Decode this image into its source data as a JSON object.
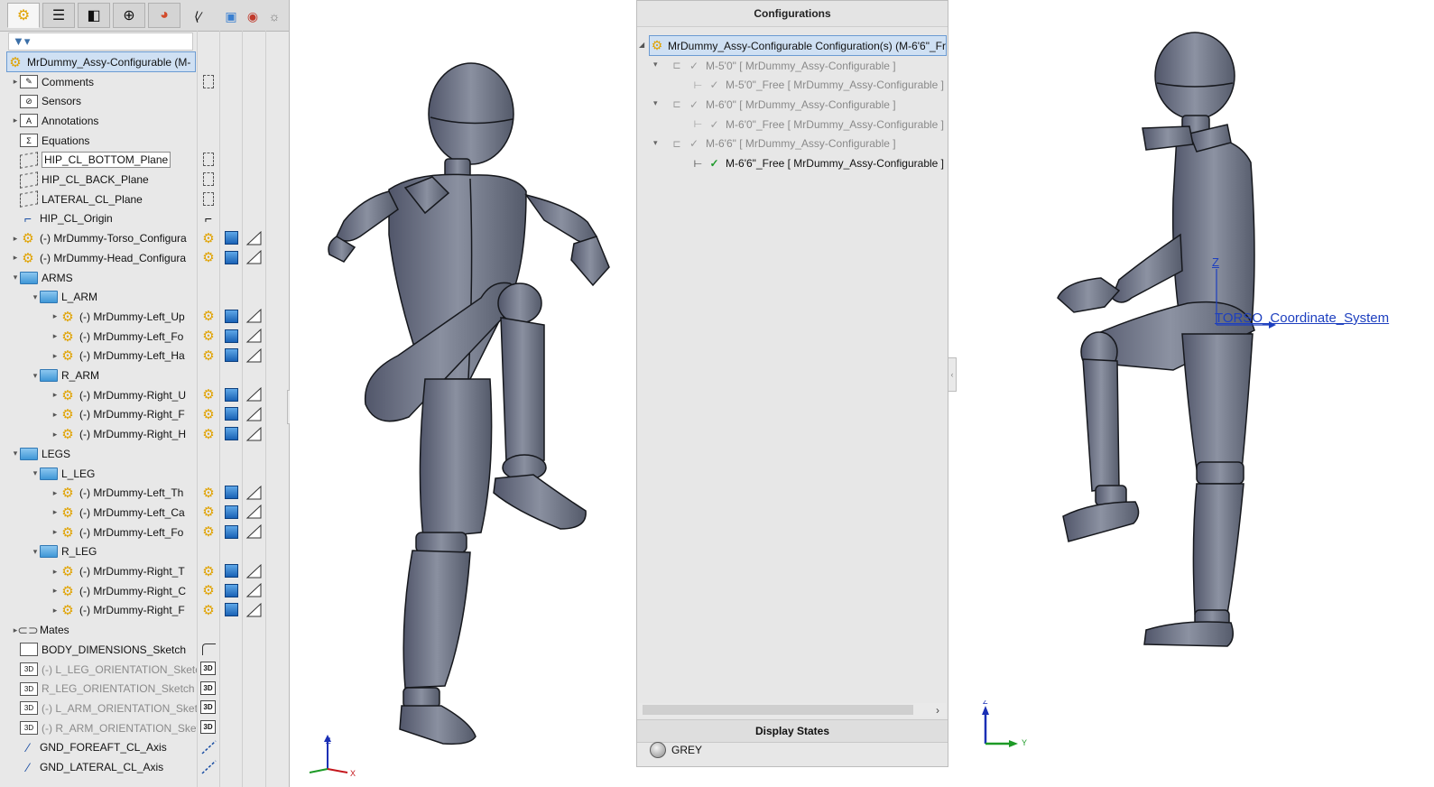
{
  "feature_manager": {
    "tabs": [
      "feature-manager-tab",
      "property-manager-tab",
      "configuration-manager-tab",
      "dimxpert-manager-tab",
      "display-manager-tab"
    ],
    "filter_placeholder": "",
    "root": {
      "label": "MrDummy_Assy-Configurable  (M-"
    },
    "items": [
      {
        "label": "Comments",
        "icon": "comments-icon"
      },
      {
        "label": "Sensors",
        "icon": "sensors-icon"
      },
      {
        "label": "Annotations",
        "icon": "annotations-icon"
      },
      {
        "label": "Equations",
        "icon": "equations-icon"
      },
      {
        "label": "HIP_CL_BOTTOM_Plane",
        "icon": "plane-icon"
      },
      {
        "label": "HIP_CL_BACK_Plane",
        "icon": "plane-icon"
      },
      {
        "label": "LATERAL_CL_Plane",
        "icon": "plane-icon"
      },
      {
        "label": "HIP_CL_Origin",
        "icon": "origin-icon"
      },
      {
        "label": "(-) MrDummy-Torso_Configura",
        "icon": "subassembly-icon"
      },
      {
        "label": "(-) MrDummy-Head_Configura",
        "icon": "subassembly-icon"
      },
      {
        "label": "ARMS",
        "icon": "folder-icon"
      },
      {
        "label": "L_ARM",
        "icon": "folder-icon"
      },
      {
        "label": "(-) MrDummy-Left_Up",
        "icon": "subassembly-icon"
      },
      {
        "label": "(-) MrDummy-Left_Fo",
        "icon": "subassembly-icon"
      },
      {
        "label": "(-) MrDummy-Left_Ha",
        "icon": "subassembly-icon"
      },
      {
        "label": "R_ARM",
        "icon": "folder-icon"
      },
      {
        "label": "(-) MrDummy-Right_U",
        "icon": "subassembly-icon"
      },
      {
        "label": "(-) MrDummy-Right_F",
        "icon": "subassembly-icon"
      },
      {
        "label": "(-) MrDummy-Right_H",
        "icon": "subassembly-icon"
      },
      {
        "label": "LEGS",
        "icon": "folder-icon"
      },
      {
        "label": "L_LEG",
        "icon": "folder-icon"
      },
      {
        "label": "(-) MrDummy-Left_Th",
        "icon": "subassembly-icon"
      },
      {
        "label": "(-) MrDummy-Left_Ca",
        "icon": "subassembly-icon"
      },
      {
        "label": "(-) MrDummy-Left_Fo",
        "icon": "subassembly-icon"
      },
      {
        "label": "R_LEG",
        "icon": "folder-icon"
      },
      {
        "label": "(-) MrDummy-Right_T",
        "icon": "subassembly-icon"
      },
      {
        "label": "(-) MrDummy-Right_C",
        "icon": "subassembly-icon"
      },
      {
        "label": "(-) MrDummy-Right_F",
        "icon": "subassembly-icon"
      },
      {
        "label": "Mates",
        "icon": "mates-icon"
      },
      {
        "label": "BODY_DIMENSIONS_Sketch",
        "icon": "sketch-icon"
      },
      {
        "label": "(-) L_LEG_ORIENTATION_Sketcl",
        "icon": "3d-sketch-icon"
      },
      {
        "label": "R_LEG_ORIENTATION_Sketch",
        "icon": "3d-sketch-icon"
      },
      {
        "label": "(-) L_ARM_ORIENTATION_Sket",
        "icon": "3d-sketch-icon"
      },
      {
        "label": "(-) R_ARM_ORIENTATION_Sket",
        "icon": "3d-sketch-icon"
      },
      {
        "label": "GND_FOREAFT_CL_Axis",
        "icon": "axis-icon"
      },
      {
        "label": "GND_LATERAL_CL_Axis",
        "icon": "axis-icon"
      }
    ],
    "badge_3d": "3D"
  },
  "configurations": {
    "title": "Configurations",
    "root_label": "MrDummy_Assy-Configurable Configuration(s)  (M-6'6\"_Fr",
    "rows": [
      {
        "label": "M-5'0\" [ MrDummy_Assy-Configurable ]",
        "active": false
      },
      {
        "label": "M-5'0\"_Free [ MrDummy_Assy-Configurable ]",
        "active": false
      },
      {
        "label": "M-6'0\" [ MrDummy_Assy-Configurable ]",
        "active": false
      },
      {
        "label": "M-6'0\"_Free [ MrDummy_Assy-Configurable ]",
        "active": false
      },
      {
        "label": "M-6'6\" [ MrDummy_Assy-Configurable ]",
        "active": false
      },
      {
        "label": "M-6'6\"_Free [ MrDummy_Assy-Configurable ]",
        "active": true
      }
    ],
    "display_states_title": "Display States",
    "display_state": "GREY"
  },
  "viewport_right": {
    "coordinate_system_label": "TORSO_Coordinate_System",
    "axis_z": "Z"
  },
  "triads": {
    "z": "Z",
    "y": "Y",
    "x": "X"
  },
  "colors": {
    "panel_bg": "#e8e8e8",
    "selection": "#cfe0f3",
    "model_grey": "#7d8290",
    "active_check": "#1f9a2c",
    "triad_z": "#1a2fb5",
    "triad_y": "#1d9a26",
    "triad_x": "#c4161c"
  }
}
